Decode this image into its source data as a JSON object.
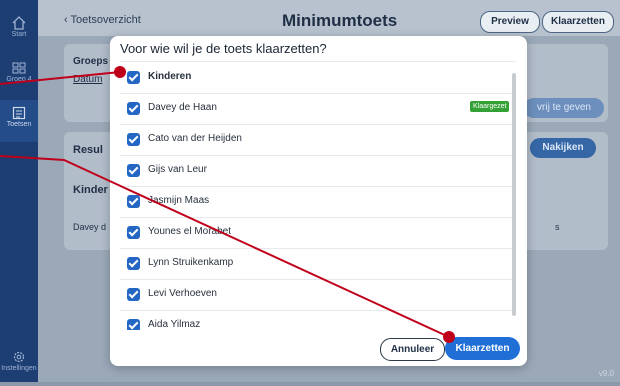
{
  "sidebar": {
    "items": [
      {
        "label": "Start",
        "icon": "home-icon"
      },
      {
        "label": "Groep 4",
        "icon": "group-icon"
      },
      {
        "label": "Toetsen",
        "icon": "tests-icon"
      },
      {
        "label": "Instellingen",
        "icon": "gear-icon"
      }
    ]
  },
  "header": {
    "back_label": "Toetsoverzicht",
    "title": "Minimumtoets",
    "preview_label": "Preview",
    "klaarzetten_label": "Klaarzetten"
  },
  "background": {
    "groeps_label": "Groeps",
    "datum_label": "Datum",
    "vrij_button": "vrij te geven",
    "resul_label": "Resul",
    "nakijken_button": "Nakijken",
    "kinder_label": "Kinder",
    "davey_label": "Davey d",
    "s_label": "s",
    "version": "v9.0"
  },
  "modal": {
    "title": "Voor wie wil je de toets klaarzetten?",
    "rows": [
      {
        "label": "Kinderen",
        "checked": true,
        "header": true
      },
      {
        "label": "Davey de Haan",
        "checked": true,
        "badge": "Klaargezet"
      },
      {
        "label": "Cato van der Heijden",
        "checked": true
      },
      {
        "label": "Gijs van Leur",
        "checked": true
      },
      {
        "label": "Jasmijn Maas",
        "checked": true
      },
      {
        "label": "Younes el Morabet",
        "checked": true
      },
      {
        "label": "Lynn Struikenkamp",
        "checked": true
      },
      {
        "label": "Levi Verhoeven",
        "checked": true
      },
      {
        "label": "Aida Yilmaz",
        "checked": true
      }
    ],
    "cancel_label": "Annuleer",
    "confirm_label": "Klaarzetten"
  },
  "colors": {
    "sidebar": "#1c3e73",
    "accent": "#1f6fd6",
    "badge": "#34a136",
    "annotation": "#c0001a"
  }
}
